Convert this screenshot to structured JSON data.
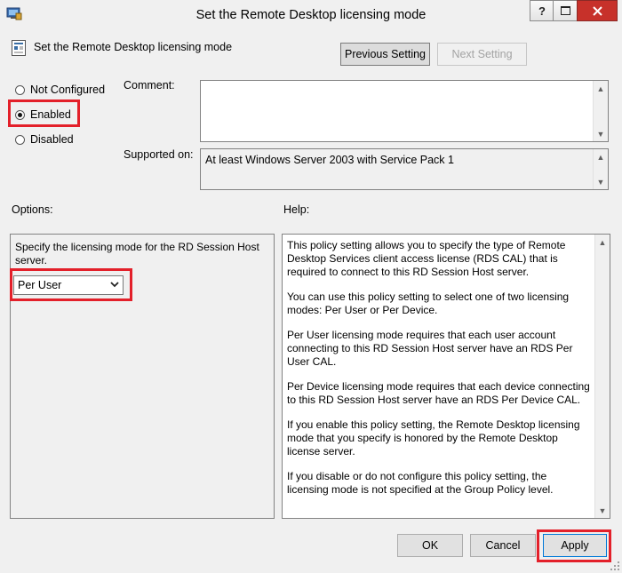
{
  "window": {
    "title": "Set the Remote Desktop licensing mode",
    "help_glyph": "?"
  },
  "header": {
    "policy_name": "Set the Remote Desktop licensing mode",
    "previous_button": "Previous Setting",
    "next_button": "Next Setting"
  },
  "state": {
    "not_configured": "Not Configured",
    "enabled": "Enabled",
    "disabled": "Disabled",
    "selected": "enabled"
  },
  "comment": {
    "label": "Comment:",
    "value": ""
  },
  "supported": {
    "label": "Supported on:",
    "value": "At least Windows Server 2003 with Service Pack 1"
  },
  "options": {
    "label": "Options:",
    "description": "Specify the licensing mode for the RD Session Host server.",
    "mode_selected": "Per User"
  },
  "help": {
    "label": "Help:",
    "paragraphs": [
      "This policy setting allows you to specify the type of Remote Desktop Services client access license (RDS CAL) that is required to connect to this RD Session Host server.",
      "You can use this policy setting to select one of two licensing modes: Per User or Per Device.",
      "Per User licensing mode requires that each user account connecting to this RD Session Host server have an RDS Per User CAL.",
      "Per Device licensing mode requires that each device connecting to this RD Session Host server have an RDS Per Device CAL.",
      "If you enable this policy setting, the Remote Desktop licensing mode that you specify is honored by the Remote Desktop license server.",
      "If you disable or do not configure this policy setting, the licensing mode is not specified at the Group Policy level."
    ]
  },
  "footer": {
    "ok": "OK",
    "cancel": "Cancel",
    "apply": "Apply"
  },
  "colors": {
    "highlight": "#e3202a",
    "close_button": "#c7312a"
  }
}
